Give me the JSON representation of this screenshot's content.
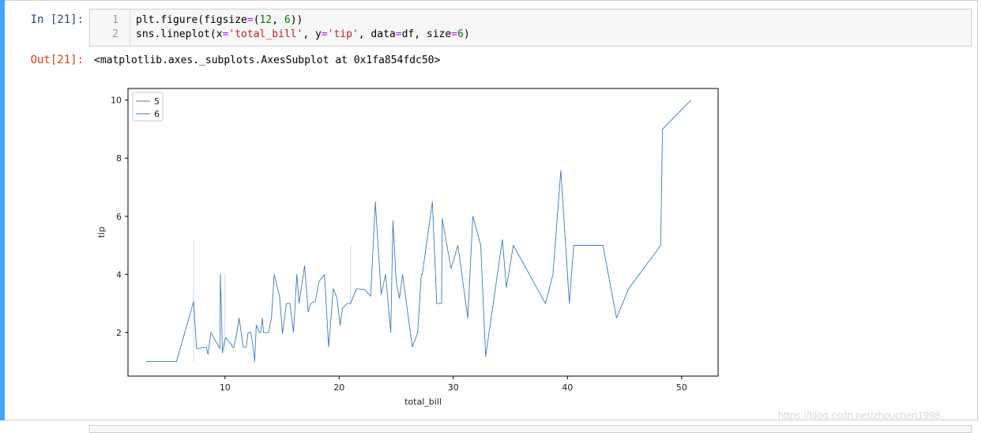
{
  "cell": {
    "in_prompt": "In  [21]:",
    "out_prompt": "Out[21]:",
    "line_numbers": [
      "1",
      "2"
    ],
    "code_line1": {
      "a": "plt.figure(figsize",
      "b": "=",
      "c": "(",
      "d": "12",
      "e": ", ",
      "f": "6",
      "g": "))"
    },
    "code_line2": {
      "a": "sns.lineplot(x",
      "b": "=",
      "c": "'total_bill'",
      "d": ", y",
      "e": "=",
      "f": "'tip'",
      "g": ", data",
      "h": "=",
      "i": "df, size",
      "j": "=",
      "k": "6",
      "l": ")"
    },
    "output_text": "<matplotlib.axes._subplots.AxesSubplot at 0x1fa854fdc50>"
  },
  "watermark": "https://blog.csdn.net/zhouchen1998",
  "colors": {
    "accent_bar": "#42a5f5",
    "line": "#3b7bbd",
    "in_prompt": "#303f9f",
    "out_prompt": "#d84315"
  },
  "chart_data": {
    "type": "line",
    "xlabel": "total_bill",
    "ylabel": "tip",
    "xlim": [
      1.5,
      53.2
    ],
    "ylim": [
      0.5,
      10.4
    ],
    "xticks": [
      10,
      20,
      30,
      40,
      50
    ],
    "yticks": [
      2,
      4,
      6,
      8,
      10
    ],
    "legend": {
      "placement": "top-left",
      "entries": [
        "5",
        "6"
      ]
    },
    "grid": false,
    "series": [
      {
        "name": "6",
        "x": [
          3.07,
          5.75,
          7.25,
          7.51,
          8.35,
          8.51,
          8.77,
          9.55,
          9.6,
          9.78,
          9.94,
          10.07,
          10.27,
          10.51,
          10.59,
          10.63,
          10.65,
          10.77,
          11.02,
          11.24,
          11.59,
          11.87,
          12.02,
          12.26,
          12.46,
          12.6,
          12.74,
          13.0,
          13.13,
          13.27,
          13.37,
          13.51,
          13.81,
          14.07,
          14.31,
          14.78,
          15.04,
          15.38,
          15.69,
          16.0,
          16.29,
          16.49,
          16.97,
          17.29,
          17.51,
          17.92,
          18.24,
          18.71,
          19.08,
          19.49,
          19.82,
          20.08,
          20.29,
          20.69,
          21.01,
          21.5,
          22.23,
          22.76,
          23.17,
          23.68,
          24.06,
          24.52,
          24.71,
          25.0,
          25.29,
          25.56,
          26.41,
          26.88,
          27.2,
          27.28,
          28.17,
          28.55,
          28.97,
          29.03,
          29.8,
          30.4,
          31.27,
          31.71,
          32.4,
          32.83,
          34.3,
          34.65,
          35.26,
          38.07,
          38.73,
          39.42,
          40.17,
          40.55,
          43.11,
          44.3,
          45.35,
          48.17,
          48.33,
          50.81
        ],
        "y": [
          1.0,
          1.0,
          3.07,
          1.44,
          1.5,
          1.25,
          2.0,
          1.45,
          4.0,
          1.3,
          1.66,
          1.83,
          1.71,
          1.61,
          1.61,
          1.5,
          1.5,
          1.47,
          1.97,
          2.5,
          1.5,
          1.5,
          2.0,
          2.0,
          1.5,
          1.0,
          2.26,
          2.0,
          2.0,
          2.5,
          2.0,
          2.0,
          2.0,
          2.5,
          4.0,
          3.23,
          1.96,
          3.0,
          3.0,
          2.0,
          4.0,
          3.0,
          4.3,
          2.71,
          3.0,
          3.08,
          3.76,
          4.0,
          1.5,
          3.51,
          3.18,
          2.24,
          2.83,
          3.0,
          3.0,
          3.5,
          3.48,
          3.25,
          6.5,
          3.31,
          4.0,
          2.0,
          5.85,
          3.75,
          3.18,
          4.0,
          1.5,
          2.0,
          4.0,
          4.0,
          6.5,
          3.0,
          3.0,
          5.92,
          4.2,
          5.0,
          2.5,
          6.0,
          5.0,
          1.17,
          5.2,
          3.55,
          5.0,
          3.0,
          4.0,
          7.58,
          3.0,
          5.0,
          5.0,
          2.5,
          3.5,
          5.0,
          9.0,
          10.0
        ]
      }
    ]
  }
}
